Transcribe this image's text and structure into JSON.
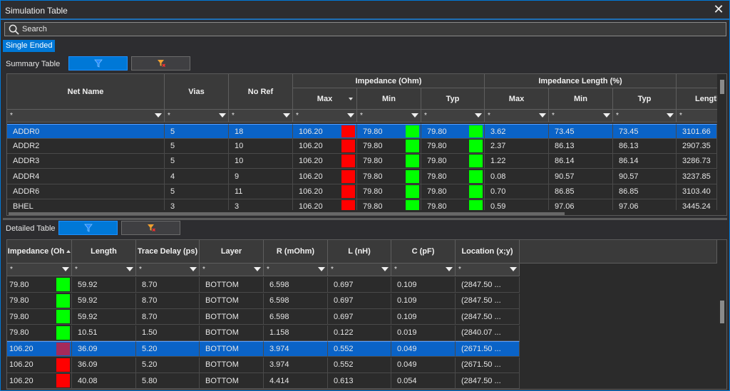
{
  "window": {
    "title": "Simulation Table",
    "close_label": "✕"
  },
  "search": {
    "placeholder": "Search"
  },
  "tabs": [
    {
      "label": "Single Ended",
      "selected": true
    }
  ],
  "summary": {
    "label": "Summary Table",
    "group_headers": {
      "impedance": "Impedance (Ohm)",
      "impedance_length": "Impedance Length (%)"
    },
    "columns": [
      "Net Name",
      "Vias",
      "No Ref",
      "Max",
      "Min",
      "Typ",
      "Max",
      "Min",
      "Typ",
      "Length"
    ],
    "filter_symbol": "*",
    "rows": [
      {
        "net": "ADDR0",
        "vias": "5",
        "noref": "18",
        "zmax": "106.20",
        "zmax_color": "#ff0000",
        "zmin": "79.80",
        "zmin_color": "#00ff00",
        "ztyp": "79.80",
        "ztyp_color": "#00ff00",
        "lmax": "3.62",
        "lmin": "73.45",
        "ltyp": "73.45",
        "len": "3101.66",
        "selected": true
      },
      {
        "net": "ADDR2",
        "vias": "5",
        "noref": "10",
        "zmax": "106.20",
        "zmax_color": "#ff0000",
        "zmin": "79.80",
        "zmin_color": "#00ff00",
        "ztyp": "79.80",
        "ztyp_color": "#00ff00",
        "lmax": "2.37",
        "lmin": "86.13",
        "ltyp": "86.13",
        "len": "2907.35",
        "selected": false
      },
      {
        "net": "ADDR3",
        "vias": "5",
        "noref": "10",
        "zmax": "106.20",
        "zmax_color": "#ff0000",
        "zmin": "79.80",
        "zmin_color": "#00ff00",
        "ztyp": "79.80",
        "ztyp_color": "#00ff00",
        "lmax": "1.22",
        "lmin": "86.14",
        "ltyp": "86.14",
        "len": "3286.73",
        "selected": false
      },
      {
        "net": "ADDR4",
        "vias": "4",
        "noref": "9",
        "zmax": "106.20",
        "zmax_color": "#ff0000",
        "zmin": "79.80",
        "zmin_color": "#00ff00",
        "ztyp": "79.80",
        "ztyp_color": "#00ff00",
        "lmax": "0.08",
        "lmin": "90.57",
        "ltyp": "90.57",
        "len": "3237.85",
        "selected": false
      },
      {
        "net": "ADDR6",
        "vias": "5",
        "noref": "11",
        "zmax": "106.20",
        "zmax_color": "#ff0000",
        "zmin": "79.80",
        "zmin_color": "#00ff00",
        "ztyp": "79.80",
        "ztyp_color": "#00ff00",
        "lmax": "0.70",
        "lmin": "86.85",
        "ltyp": "86.85",
        "len": "3103.40",
        "selected": false
      },
      {
        "net": "BHEL",
        "vias": "3",
        "noref": "3",
        "zmax": "106.20",
        "zmax_color": "#ff0000",
        "zmin": "79.80",
        "zmin_color": "#00ff00",
        "ztyp": "79.80",
        "ztyp_color": "#00ff00",
        "lmax": "0.59",
        "lmin": "97.06",
        "ltyp": "97.06",
        "len": "3445.24",
        "selected": false
      }
    ]
  },
  "detailed": {
    "label": "Detailed Table",
    "columns": [
      "Impedance (Oh",
      "Length",
      "Trace Delay (ps)",
      "Layer",
      "R (mOhm)",
      "L (nH)",
      "C (pF)",
      "Location (x;y)"
    ],
    "filter_symbol": "*",
    "rows": [
      {
        "imp": "79.80",
        "imp_color": "#00ff00",
        "length": "59.92",
        "delay": "8.70",
        "layer": "BOTTOM",
        "r": "6.598",
        "l": "0.697",
        "c": "0.109",
        "loc": "(2847.50 ...",
        "selected": false
      },
      {
        "imp": "79.80",
        "imp_color": "#00ff00",
        "length": "59.92",
        "delay": "8.70",
        "layer": "BOTTOM",
        "r": "6.598",
        "l": "0.697",
        "c": "0.109",
        "loc": "(2847.50 ...",
        "selected": false
      },
      {
        "imp": "79.80",
        "imp_color": "#00ff00",
        "length": "59.92",
        "delay": "8.70",
        "layer": "BOTTOM",
        "r": "6.598",
        "l": "0.697",
        "c": "0.109",
        "loc": "(2847.50 ...",
        "selected": false
      },
      {
        "imp": "79.80",
        "imp_color": "#00ff00",
        "length": "10.51",
        "delay": "1.50",
        "layer": "BOTTOM",
        "r": "1.158",
        "l": "0.122",
        "c": "0.019",
        "loc": "(2840.07 ...",
        "selected": false
      },
      {
        "imp": "106.20",
        "imp_color": "#a52a5a",
        "length": "36.09",
        "delay": "5.20",
        "layer": "BOTTOM",
        "r": "3.974",
        "l": "0.552",
        "c": "0.049",
        "loc": "(2671.50 ...",
        "selected": true
      },
      {
        "imp": "106.20",
        "imp_color": "#ff0000",
        "length": "36.09",
        "delay": "5.20",
        "layer": "BOTTOM",
        "r": "3.974",
        "l": "0.552",
        "c": "0.049",
        "loc": "(2671.50 ...",
        "selected": false
      },
      {
        "imp": "106.20",
        "imp_color": "#ff0000",
        "length": "40.08",
        "delay": "5.80",
        "layer": "BOTTOM",
        "r": "4.414",
        "l": "0.613",
        "c": "0.054",
        "loc": "(2847.50 ...",
        "selected": false
      }
    ]
  },
  "colors": {
    "accent": "#0078d7",
    "selected_row": "#0a63c7",
    "good": "#00ff00",
    "bad": "#ff0000"
  },
  "icons": {
    "search": "search-icon",
    "filter": "filter-icon",
    "clear_filter": "clear-filter-icon",
    "close": "close-icon"
  }
}
